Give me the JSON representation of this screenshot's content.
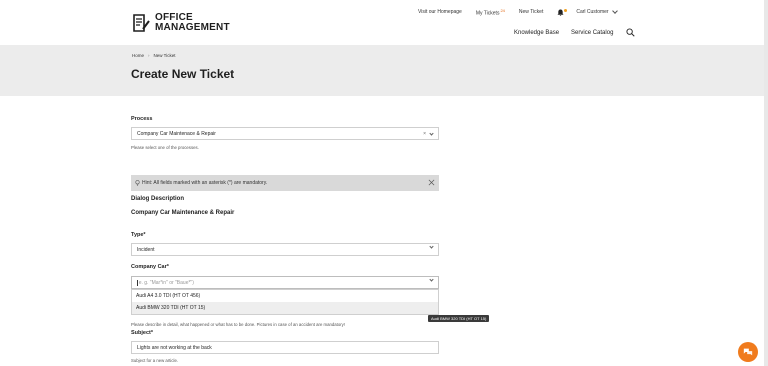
{
  "brand": {
    "line1": "OFFICE",
    "line2": "MANAGEMENT"
  },
  "top_nav": {
    "homepage": "Visit our Homepage",
    "my_tickets": "My Tickets",
    "my_tickets_badge": "24",
    "new_ticket": "New Ticket",
    "user": "Carl Customer"
  },
  "main_nav": {
    "knowledge_base": "Knowledge Base",
    "service_catalog": "Service Catalog"
  },
  "breadcrumb": {
    "home": "Home",
    "current": "New Ticket"
  },
  "page_title": "Create New Ticket",
  "form": {
    "process_label": "Process",
    "process_value": "Company Car Maintenace & Repair",
    "process_help": "Please select one of the processes.",
    "hint": "Hint: All fields marked with an asterisk (*) are mandatory.",
    "dialog_desc_label": "Dialog Description",
    "dialog_desc_value": "Company Car Maintenance & Repair",
    "type_label": "Type*",
    "type_value": "Incident",
    "car_label": "Company Car*",
    "car_placeholder": "e. g. \"Mar*in\" or \"Baue*\")",
    "car_options": [
      "Audi A4 3.0 TDI (HT OT 456)",
      "Audi BMW 320 TDI (HT OT 15)"
    ],
    "description_help": "Please describe in detail, what happened or what has to be done. Pictures in case of an accident are mandatory!",
    "subject_label": "Subject*",
    "subject_value": "Lights are not working at the back",
    "subject_help": "Subject for a new article."
  },
  "tooltip": "Audi BMW 320 TDI (HT OT 15)",
  "colors": {
    "accent": "#f07b1d",
    "banner": "#ececec"
  }
}
